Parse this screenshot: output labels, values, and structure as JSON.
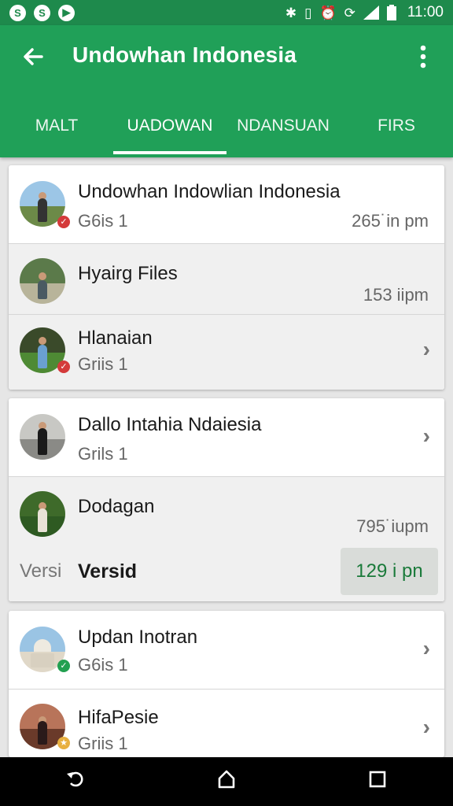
{
  "status_bar": {
    "left_icons": [
      "S",
      "S",
      "▶"
    ],
    "right_icons": [
      "bluetooth-icon",
      "vibrate-icon",
      "alarm-icon",
      "sync-icon",
      "signal-icon",
      "battery-icon"
    ],
    "time": "11:00"
  },
  "app_bar": {
    "title": "Undowhan Indonesia",
    "back_icon": "back-arrow-icon",
    "more_icon": "more-vert-icon"
  },
  "tabs": [
    {
      "label": "MALT",
      "active": false
    },
    {
      "label": "UADOWAN",
      "active": true
    },
    {
      "label": "NDANSUAN",
      "active": false
    },
    {
      "label": "FIRS",
      "active": false
    }
  ],
  "cards": [
    {
      "rows": [
        {
          "title": "Undowhan Indowlian Indonesia",
          "subtitle": "G6is 1",
          "time": "265˙in pm"
        },
        {
          "title": "Hyairg Files",
          "subtitle": "",
          "time": "153 iipm"
        },
        {
          "title": "Hlanaian",
          "subtitle": "Griis 1",
          "time": ""
        }
      ]
    },
    {
      "rows": [
        {
          "title": "Dallo Intahia Ndaiesia",
          "subtitle": "Grils 1",
          "time": ""
        },
        {
          "title": "Dodagan",
          "subtitle": "",
          "time": "795˙iupm",
          "footer_left": "Versi",
          "footer_label": "Versid",
          "footer_time": "129 i pn"
        }
      ]
    },
    {
      "rows": [
        {
          "title": "Updan Inotran",
          "subtitle": "G6is 1",
          "time": ""
        },
        {
          "title": "HifaPesie",
          "subtitle": "Griis 1",
          "time": ""
        }
      ]
    }
  ],
  "nav_bar": {
    "back_icon": "nav-back-icon",
    "home_icon": "nav-home-icon",
    "recents_icon": "nav-recents-icon"
  },
  "colors": {
    "status_bar": "#1e8a4c",
    "app_bar": "#20a058",
    "accent_green": "#1a7a3a"
  }
}
